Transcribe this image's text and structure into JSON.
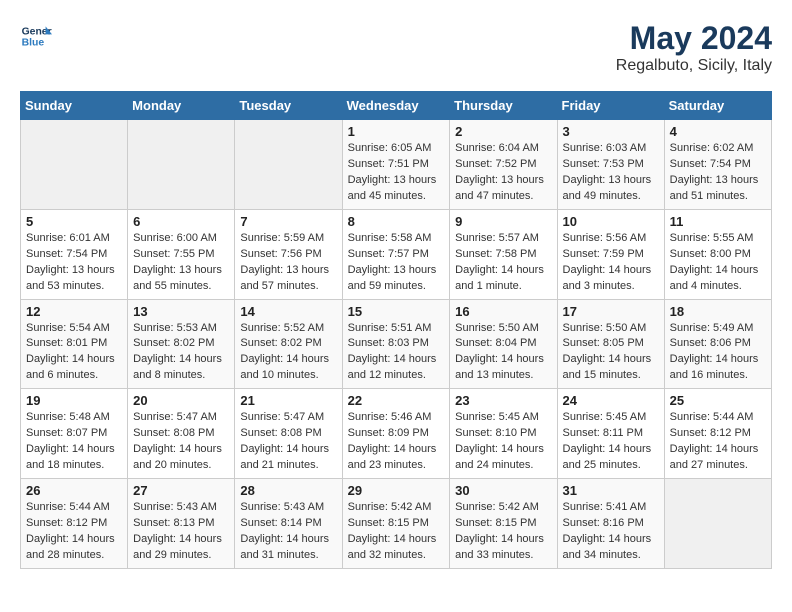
{
  "header": {
    "logo_line1": "General",
    "logo_line2": "Blue",
    "main_title": "May 2024",
    "subtitle": "Regalbuto, Sicily, Italy"
  },
  "days_of_week": [
    "Sunday",
    "Monday",
    "Tuesday",
    "Wednesday",
    "Thursday",
    "Friday",
    "Saturday"
  ],
  "weeks": [
    [
      {
        "day": "",
        "info": ""
      },
      {
        "day": "",
        "info": ""
      },
      {
        "day": "",
        "info": ""
      },
      {
        "day": "1",
        "info": "Sunrise: 6:05 AM\nSunset: 7:51 PM\nDaylight: 13 hours\nand 45 minutes."
      },
      {
        "day": "2",
        "info": "Sunrise: 6:04 AM\nSunset: 7:52 PM\nDaylight: 13 hours\nand 47 minutes."
      },
      {
        "day": "3",
        "info": "Sunrise: 6:03 AM\nSunset: 7:53 PM\nDaylight: 13 hours\nand 49 minutes."
      },
      {
        "day": "4",
        "info": "Sunrise: 6:02 AM\nSunset: 7:54 PM\nDaylight: 13 hours\nand 51 minutes."
      }
    ],
    [
      {
        "day": "5",
        "info": "Sunrise: 6:01 AM\nSunset: 7:54 PM\nDaylight: 13 hours\nand 53 minutes."
      },
      {
        "day": "6",
        "info": "Sunrise: 6:00 AM\nSunset: 7:55 PM\nDaylight: 13 hours\nand 55 minutes."
      },
      {
        "day": "7",
        "info": "Sunrise: 5:59 AM\nSunset: 7:56 PM\nDaylight: 13 hours\nand 57 minutes."
      },
      {
        "day": "8",
        "info": "Sunrise: 5:58 AM\nSunset: 7:57 PM\nDaylight: 13 hours\nand 59 minutes."
      },
      {
        "day": "9",
        "info": "Sunrise: 5:57 AM\nSunset: 7:58 PM\nDaylight: 14 hours\nand 1 minute."
      },
      {
        "day": "10",
        "info": "Sunrise: 5:56 AM\nSunset: 7:59 PM\nDaylight: 14 hours\nand 3 minutes."
      },
      {
        "day": "11",
        "info": "Sunrise: 5:55 AM\nSunset: 8:00 PM\nDaylight: 14 hours\nand 4 minutes."
      }
    ],
    [
      {
        "day": "12",
        "info": "Sunrise: 5:54 AM\nSunset: 8:01 PM\nDaylight: 14 hours\nand 6 minutes."
      },
      {
        "day": "13",
        "info": "Sunrise: 5:53 AM\nSunset: 8:02 PM\nDaylight: 14 hours\nand 8 minutes."
      },
      {
        "day": "14",
        "info": "Sunrise: 5:52 AM\nSunset: 8:02 PM\nDaylight: 14 hours\nand 10 minutes."
      },
      {
        "day": "15",
        "info": "Sunrise: 5:51 AM\nSunset: 8:03 PM\nDaylight: 14 hours\nand 12 minutes."
      },
      {
        "day": "16",
        "info": "Sunrise: 5:50 AM\nSunset: 8:04 PM\nDaylight: 14 hours\nand 13 minutes."
      },
      {
        "day": "17",
        "info": "Sunrise: 5:50 AM\nSunset: 8:05 PM\nDaylight: 14 hours\nand 15 minutes."
      },
      {
        "day": "18",
        "info": "Sunrise: 5:49 AM\nSunset: 8:06 PM\nDaylight: 14 hours\nand 16 minutes."
      }
    ],
    [
      {
        "day": "19",
        "info": "Sunrise: 5:48 AM\nSunset: 8:07 PM\nDaylight: 14 hours\nand 18 minutes."
      },
      {
        "day": "20",
        "info": "Sunrise: 5:47 AM\nSunset: 8:08 PM\nDaylight: 14 hours\nand 20 minutes."
      },
      {
        "day": "21",
        "info": "Sunrise: 5:47 AM\nSunset: 8:08 PM\nDaylight: 14 hours\nand 21 minutes."
      },
      {
        "day": "22",
        "info": "Sunrise: 5:46 AM\nSunset: 8:09 PM\nDaylight: 14 hours\nand 23 minutes."
      },
      {
        "day": "23",
        "info": "Sunrise: 5:45 AM\nSunset: 8:10 PM\nDaylight: 14 hours\nand 24 minutes."
      },
      {
        "day": "24",
        "info": "Sunrise: 5:45 AM\nSunset: 8:11 PM\nDaylight: 14 hours\nand 25 minutes."
      },
      {
        "day": "25",
        "info": "Sunrise: 5:44 AM\nSunset: 8:12 PM\nDaylight: 14 hours\nand 27 minutes."
      }
    ],
    [
      {
        "day": "26",
        "info": "Sunrise: 5:44 AM\nSunset: 8:12 PM\nDaylight: 14 hours\nand 28 minutes."
      },
      {
        "day": "27",
        "info": "Sunrise: 5:43 AM\nSunset: 8:13 PM\nDaylight: 14 hours\nand 29 minutes."
      },
      {
        "day": "28",
        "info": "Sunrise: 5:43 AM\nSunset: 8:14 PM\nDaylight: 14 hours\nand 31 minutes."
      },
      {
        "day": "29",
        "info": "Sunrise: 5:42 AM\nSunset: 8:15 PM\nDaylight: 14 hours\nand 32 minutes."
      },
      {
        "day": "30",
        "info": "Sunrise: 5:42 AM\nSunset: 8:15 PM\nDaylight: 14 hours\nand 33 minutes."
      },
      {
        "day": "31",
        "info": "Sunrise: 5:41 AM\nSunset: 8:16 PM\nDaylight: 14 hours\nand 34 minutes."
      },
      {
        "day": "",
        "info": ""
      }
    ]
  ]
}
